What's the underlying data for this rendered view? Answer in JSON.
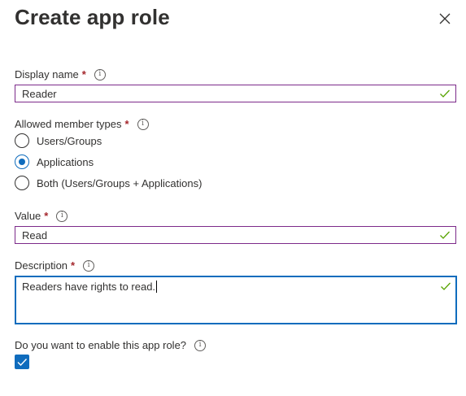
{
  "panel": {
    "title": "Create app role",
    "close_icon": "close-icon"
  },
  "display_name": {
    "label": "Display name",
    "required": "*",
    "info": "i",
    "value": "Reader"
  },
  "member_types": {
    "label": "Allowed member types",
    "required": "*",
    "info": "i",
    "options": [
      {
        "label": "Users/Groups",
        "selected": false
      },
      {
        "label": "Applications",
        "selected": true
      },
      {
        "label": "Both (Users/Groups + Applications)",
        "selected": false
      }
    ]
  },
  "value_field": {
    "label": "Value",
    "required": "*",
    "info": "i",
    "value": "Read"
  },
  "description": {
    "label": "Description",
    "required": "*",
    "info": "i",
    "value": "Readers have rights to read."
  },
  "enable": {
    "label": "Do you want to enable this app role?",
    "info": "i",
    "checked": true
  },
  "colors": {
    "accent": "#0f6cbd",
    "valid_border": "#7c2a8a",
    "required": "#a4262c",
    "valid_check": "#57a300"
  }
}
